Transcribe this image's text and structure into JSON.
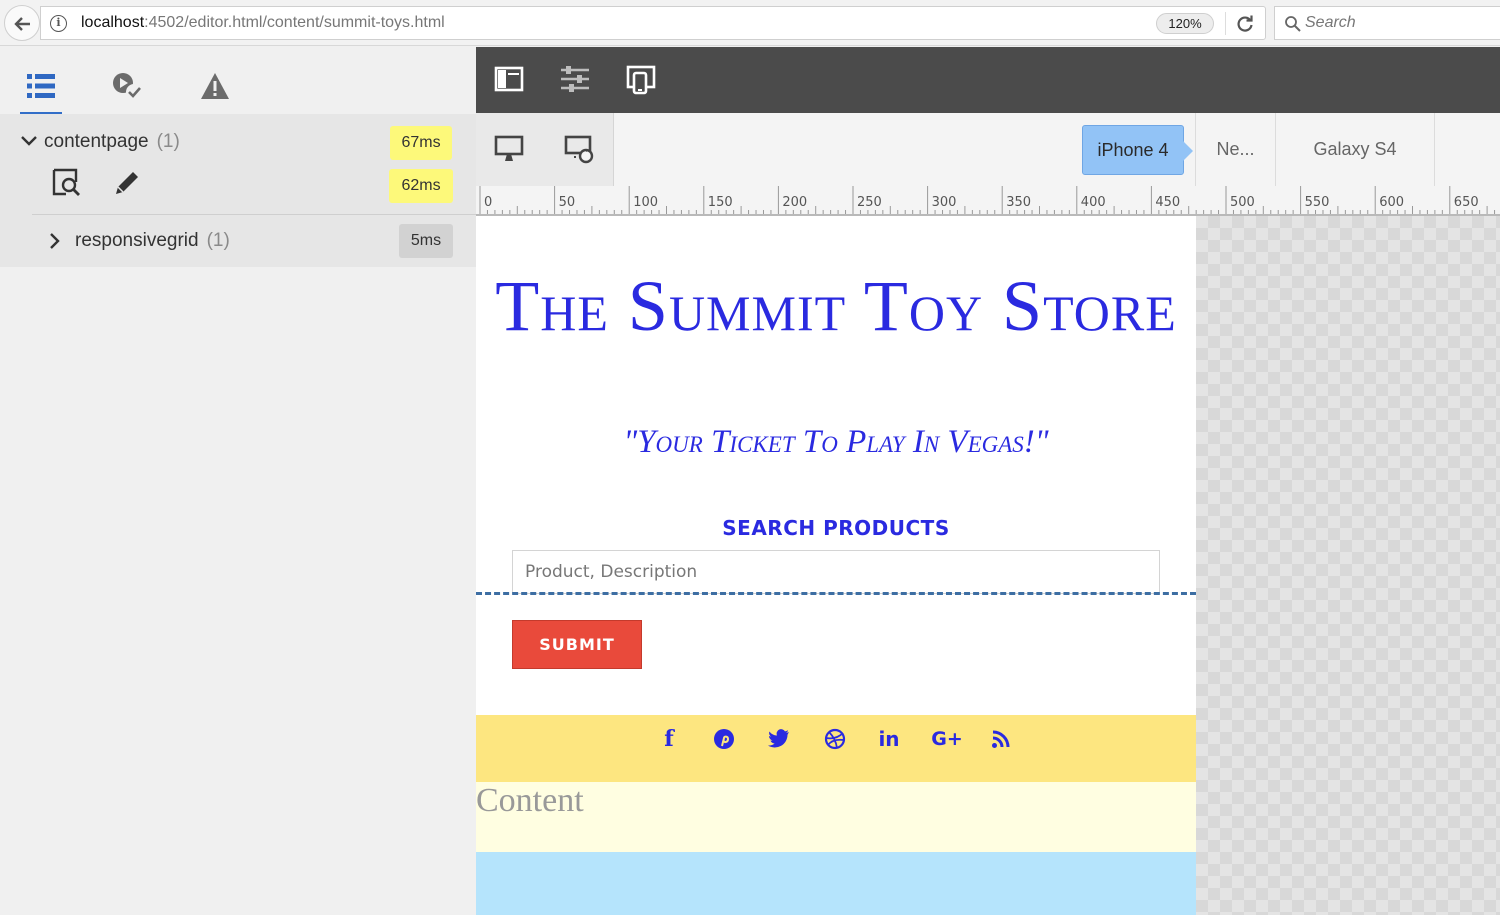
{
  "browser": {
    "url_host": "localhost",
    "url_path": ":4502/editor.html/content/summit-toys.html",
    "zoom": "120%",
    "search_placeholder": "Search"
  },
  "left_panel": {
    "tabs": [
      {
        "name": "component-tree",
        "icon": "list-icon",
        "active": true
      },
      {
        "name": "checks",
        "icon": "play-check-icon",
        "active": false
      },
      {
        "name": "warnings",
        "icon": "warning-icon",
        "active": false
      }
    ],
    "tree": [
      {
        "label": "contentpage",
        "count": "(1)",
        "expanded": true,
        "timing": "67ms",
        "sub_timing": "62ms",
        "timing_color": "#fdf97a"
      },
      {
        "label": "responsivegrid",
        "count": "(1)",
        "expanded": false,
        "timing": "5ms",
        "timing_color": "#d2d2d2"
      }
    ]
  },
  "editor_toolbar": {
    "icons": [
      "side-panel-icon",
      "properties-icon",
      "emulator-icon"
    ]
  },
  "emulator": {
    "devices": [
      {
        "label": "iPhone 4",
        "active": true
      },
      {
        "label": "Ne...",
        "active": false
      },
      {
        "label": "Galaxy S4",
        "active": false
      }
    ]
  },
  "ruler": {
    "labels": [
      "0",
      "50",
      "100",
      "150",
      "200",
      "250",
      "300",
      "350",
      "400",
      "450",
      "500",
      "550",
      "600",
      "650"
    ]
  },
  "page": {
    "title": "The Summit Toy Store",
    "tagline": "\"Your Ticket To Play In Vegas!\"",
    "search_heading": "SEARCH PRODUCTS",
    "search_placeholder": "Product, Description",
    "submit_label": "SUBMIT",
    "social_icons": [
      "facebook-icon",
      "pinterest-icon",
      "twitter-icon",
      "dribbble-icon",
      "linkedin-icon",
      "google-plus-icon",
      "rss-icon"
    ],
    "social_glyphs": {
      "facebook": "f",
      "linkedin": "in",
      "google_plus": "G+"
    },
    "content_label": "Content",
    "colors": {
      "title": "#2a2ae0",
      "submit": "#e94a3b",
      "social_bar": "#fde680",
      "content_bg": "#fffee1",
      "footer_bg": "#b5e4fc"
    }
  }
}
